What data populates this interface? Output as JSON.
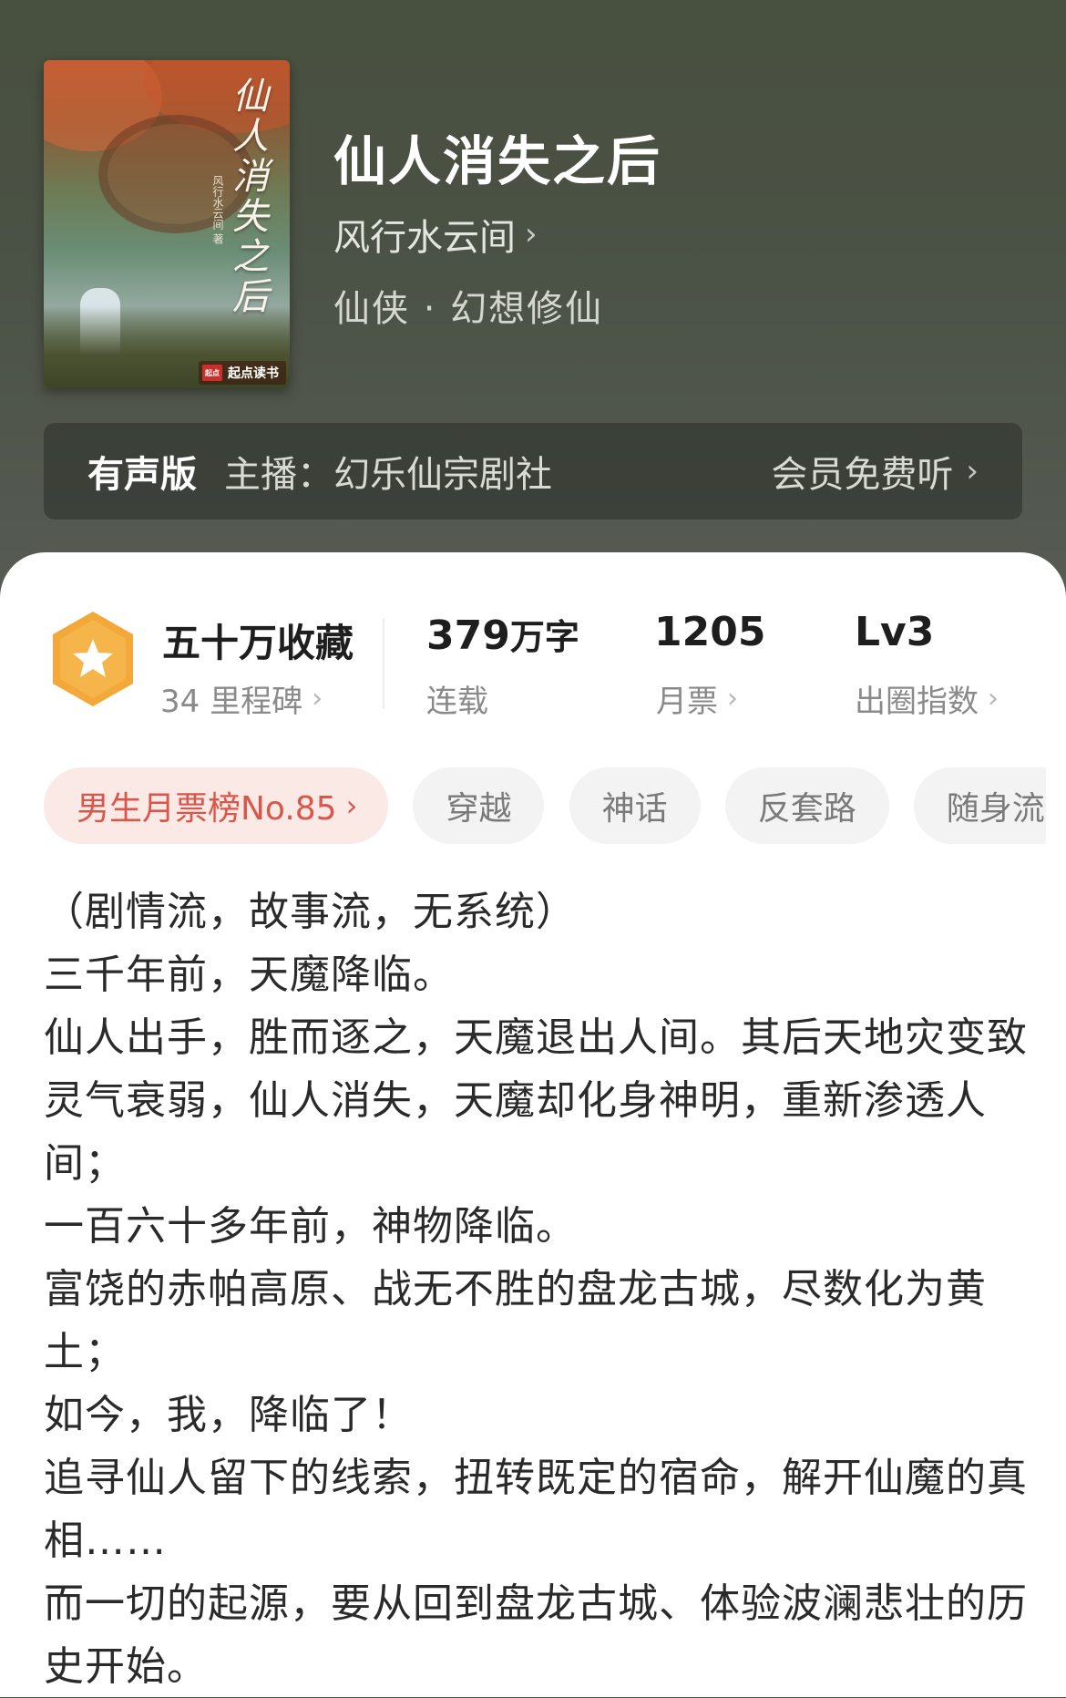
{
  "book": {
    "title": "仙人消失之后",
    "author": "风行水云间",
    "genre": "仙侠 · 幻想修仙",
    "cover": {
      "title_vertical": "仙人消失之后",
      "author_small": "风行水云间 著",
      "brand": "起点读书"
    }
  },
  "audio": {
    "label": "有声版",
    "anchor": "主播：幻乐仙宗剧社",
    "cta": "会员免费听"
  },
  "stats": {
    "favorites": "五十万收藏",
    "milestones": "34 里程碑",
    "word_count": "379",
    "word_unit": "万字",
    "status": "连载",
    "monthly_votes": "1205",
    "monthly_votes_label": "月票",
    "level": "Lv3",
    "level_label": "出圈指数"
  },
  "tags": [
    "男生月票榜No.85",
    "穿越",
    "神话",
    "反套路",
    "随身流"
  ],
  "synopsis": [
    "（剧情流，故事流，无系统）",
    "三千年前，天魔降临。",
    "仙人出手，胜而逐之，天魔退出人间。其后天地灾变致灵气衰弱，仙人消失，天魔却化身神明，重新渗透人间；",
    "一百六十多年前，神物降临。",
    "富饶的赤帕高原、战无不胜的盘龙古城，尽数化为黄土；",
    "如今，我，降临了！",
    "追寻仙人留下的线索，扭转既定的宿命，解开仙魔的真相……",
    "而一切的起源，要从回到盘龙古城、体验波澜悲壮的历史开始。"
  ],
  "icons": {
    "badge": "star-hexagon-icon",
    "chevron": "chevron-right-icon"
  },
  "colors": {
    "header": "#4b5246",
    "badge": "#f3a83a",
    "rank_tag_text": "#d8574a",
    "rank_tag_bg": "#fbe9e6"
  }
}
